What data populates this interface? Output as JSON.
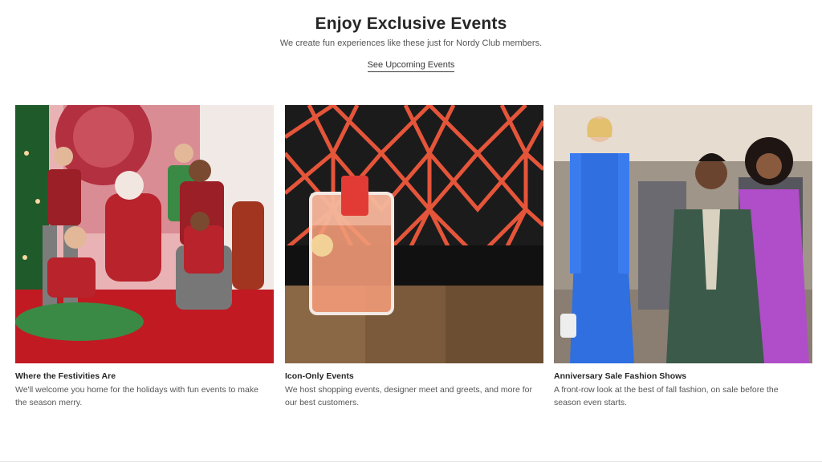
{
  "header": {
    "title": "Enjoy Exclusive Events",
    "subtitle": "We create fun experiences like these just for Nordy Club members.",
    "cta_label": "See Upcoming Events"
  },
  "cards": [
    {
      "title": "Where the Festivities Are",
      "description": "We'll welcome you home for the holidays with fun events to make the season merry."
    },
    {
      "title": "Icon-Only Events",
      "description": "We host shopping events, designer meet and greets, and more for our best customers."
    },
    {
      "title": "Anniversary Sale Fashion Shows",
      "description": "A front-row look at the best of fall fashion, on sale before the season even starts."
    }
  ],
  "colors": {
    "heading": "#262626",
    "body_text": "#555555",
    "festive_red": "#b8232c",
    "festive_green": "#3a8a45",
    "coral": "#e4553a",
    "royal_blue": "#2f6fe0",
    "orchid": "#b04dc8"
  }
}
